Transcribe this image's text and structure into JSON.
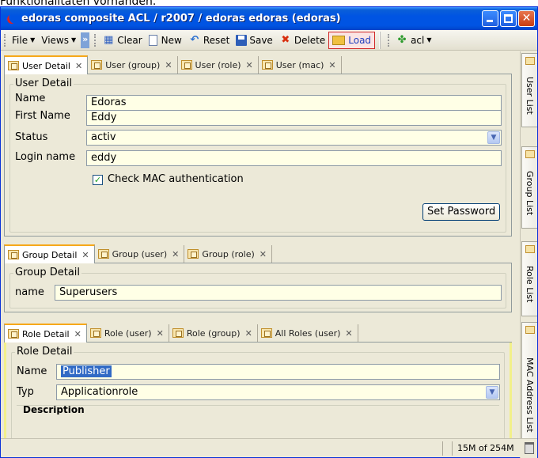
{
  "window": {
    "title": "edoras composite ACL / r2007 / edoras edoras (edoras)"
  },
  "top_partial_text": "Funktionalitäten vorhanden.",
  "toolbar": {
    "file_label": "File",
    "views_label": "Views",
    "clear_label": "Clear",
    "new_label": "New",
    "reset_label": "Reset",
    "save_label": "Save",
    "delete_label": "Delete",
    "load_label": "Load",
    "acl_label": "acl"
  },
  "user_section": {
    "tabs": [
      {
        "label": "User Detail"
      },
      {
        "label": "User (group)"
      },
      {
        "label": "User (role)"
      },
      {
        "label": "User (mac)"
      }
    ],
    "legend": "User Detail",
    "name_label": "Name",
    "name_value": "Edoras",
    "first_name_label": "First Name",
    "first_name_value": "Eddy",
    "status_label": "Status",
    "status_value": "activ",
    "login_label": "Login name",
    "login_value": "eddy",
    "mac_label": "Check MAC authentication",
    "set_password_label": "Set Password"
  },
  "group_section": {
    "tabs": [
      {
        "label": "Group Detail"
      },
      {
        "label": "Group (user)"
      },
      {
        "label": "Group (role)"
      }
    ],
    "legend": "Group Detail",
    "name_label": "name",
    "name_value": "Superusers"
  },
  "role_section": {
    "tabs": [
      {
        "label": "Role Detail"
      },
      {
        "label": "Role (user)"
      },
      {
        "label": "Role (group)"
      },
      {
        "label": "All Roles (user)"
      }
    ],
    "legend": "Role Detail",
    "name_label": "Name",
    "name_value": "Publisher",
    "typ_label": "Typ",
    "typ_value": "Applicationrole",
    "description_label": "Description"
  },
  "side_tabs": [
    "User List",
    "Group List",
    "Role List",
    "MAC Address List"
  ],
  "status": {
    "memory": "15M of 254M"
  },
  "colors": {
    "title_bar": "#0054e3",
    "field_bg": "#ffffe6",
    "selection": "#316ac5",
    "active_tab_accent": "#f6a81a"
  }
}
